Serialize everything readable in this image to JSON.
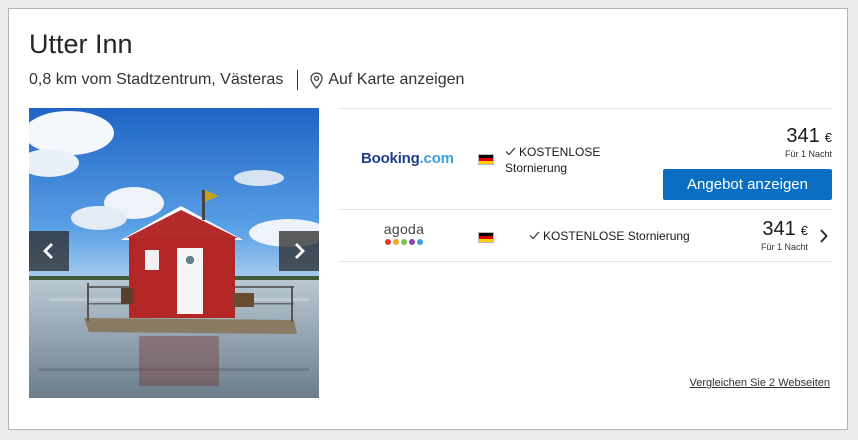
{
  "hotel": {
    "name": "Utter Inn",
    "location": "0,8 km vom Stadtzentrum, Västeras",
    "map_link": "Auf Karte anzeigen"
  },
  "offers": [
    {
      "provider": {
        "part1": "Booking",
        "part2": ".com"
      },
      "flag": "de-flag-icon",
      "cancellation": "KOSTENLOSE Stornierung",
      "price": "341",
      "currency": "€",
      "price_note": "Für 1 Nacht",
      "button": "Angebot anzeigen"
    },
    {
      "provider_name": "agoda",
      "flag": "de-flag-icon",
      "cancellation": "KOSTENLOSE Stornierung",
      "price": "341",
      "currency": "€",
      "price_note": "Für 1 Nacht"
    }
  ],
  "compare_link": "Vergleichen Sie 2 Webseiten",
  "colors": {
    "button": "#0a6fc2",
    "booking_blue": "#1f3f8a",
    "booking_light": "#3aa0e0",
    "agoda_dots": [
      "#e8372c",
      "#f5a623",
      "#7cc24e",
      "#8e44ad",
      "#3aa0e0"
    ]
  }
}
